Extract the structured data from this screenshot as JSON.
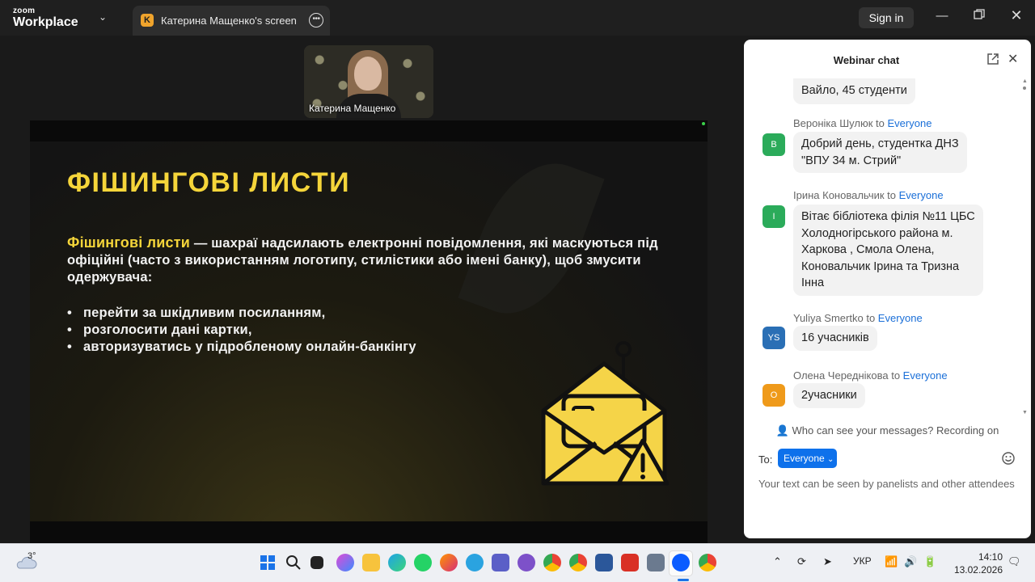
{
  "titlebar": {
    "brand_top": "zoom",
    "brand_bottom": "Workplace",
    "tab_badge": "K",
    "tab_title": "Катерина Мащенко's screen",
    "signin_label": "Sign in"
  },
  "video": {
    "participant_name": "Катерина Мащенко"
  },
  "slide": {
    "title": "ФІШИНГОВІ ЛИСТИ",
    "body_highlight": "Фішингові листи",
    "body_text": " — шахраї надсилають електронні повідомлення, які маскуються під офіційні (часто з використанням логотипу, стилістики або імені банку), щоб змусити одержувача:",
    "bullets": [
      "перейти за шкідливим посиланням,",
      "розголосити дані картки,",
      "авторизуватись у підробленому онлайн-банкінгу"
    ]
  },
  "chat": {
    "title": "Webinar chat",
    "messages": [
      {
        "sender": "",
        "target": "",
        "avatar": "",
        "avatar_color": "",
        "text_lines": [
          "Вайло,  45 студенти"
        ]
      },
      {
        "sender": "Вероніка Шулюк",
        "to": "to",
        "target": "Everyone",
        "avatar": "В",
        "avatar_color": "#2bab5a",
        "text_lines": [
          "Добрий день, студентка ДНЗ",
          "\"ВПУ 34 м. Стрий\""
        ]
      },
      {
        "sender": "Ірина Коновальчик",
        "to": "to",
        "target": "Everyone",
        "avatar": "І",
        "avatar_color": "#2bab5a",
        "text_lines": [
          "Вітає бібліотека філія №11 ЦБС",
          "Холодногірського района м.",
          "Харкова , Смола Олена,",
          "Коновальчик Ірина та Тризна",
          "Інна"
        ]
      },
      {
        "sender": "Yuliya Smertko",
        "to": "to",
        "target": "Everyone",
        "avatar": "YS",
        "avatar_color": "#2a6fb5",
        "text_lines": [
          "16 учасників"
        ]
      },
      {
        "sender": "Олена Череднікова",
        "to": "to",
        "target": "Everyone",
        "avatar": "О",
        "avatar_color": "#ef9a1a",
        "text_lines": [
          "2учасники"
        ]
      }
    ],
    "privacy_notice": "Who can see your messages? Recording on",
    "to_label": "To:",
    "to_value": "Everyone",
    "input_placeholder": "Your text can be seen by panelists and other attendees"
  },
  "taskbar": {
    "weather_temp": "3°",
    "language": "УКР",
    "time": "14:10",
    "date": "13.02.2026"
  }
}
